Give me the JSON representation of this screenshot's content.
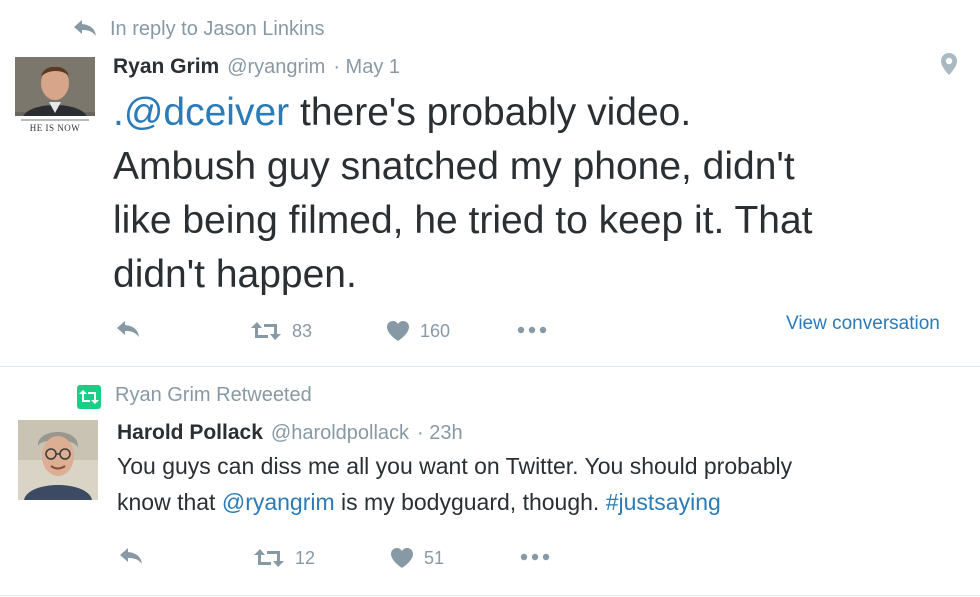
{
  "colors": {
    "link": "#2b7bb9",
    "muted": "#8899a6",
    "text": "#292f33",
    "retweet_green": "#19cf86"
  },
  "tweets": [
    {
      "context": {
        "icon": "reply-arrow-icon",
        "text": "In reply to Jason Linkins"
      },
      "author": {
        "name": "Ryan Grim",
        "handle": "@ryangrim",
        "time": "· May 1"
      },
      "avatar_caption": "HE IS NOW",
      "text": {
        "line1_mention": ".@dceiver",
        "line1_rest": " there's probably video.",
        "line2": "Ambush guy snatched my phone, didn't",
        "line3": "like being filmed, he tried to keep it. That",
        "line4": "didn't happen."
      },
      "actions": {
        "retweets": "83",
        "likes": "160"
      },
      "view_conversation": "View conversation",
      "location_icon": "location-pin-icon"
    },
    {
      "context": {
        "icon": "retweet-icon",
        "text": "Ryan Grim Retweeted"
      },
      "author": {
        "name": "Harold Pollack",
        "handle": "@haroldpollack",
        "time": "· 23h"
      },
      "text": {
        "line1": "You guys can diss me all you want on Twitter. You should probably",
        "line2_pre": "know that ",
        "line2_mention": "@ryangrim",
        "line2_mid": " is my bodyguard, though. ",
        "line2_hashtag": "#justsaying"
      },
      "actions": {
        "retweets": "12",
        "likes": "51"
      }
    }
  ]
}
